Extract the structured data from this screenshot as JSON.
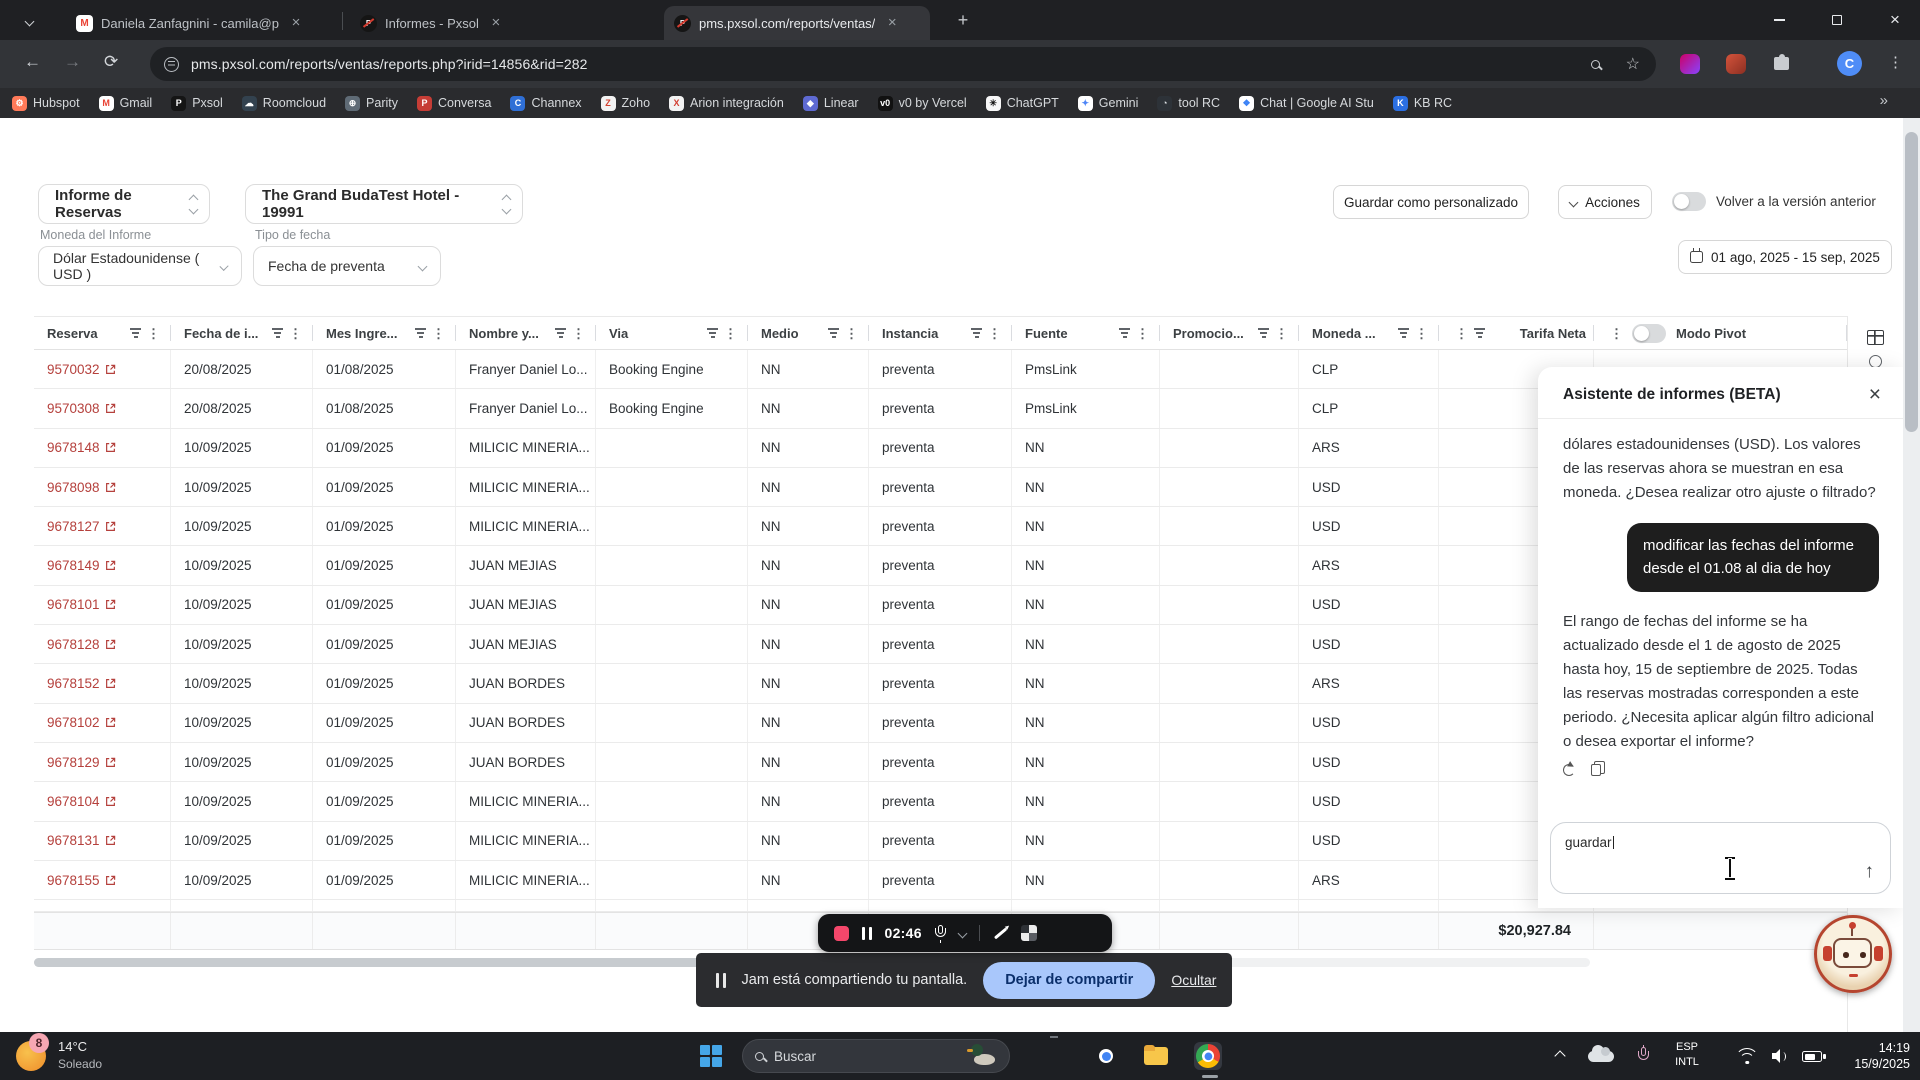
{
  "browser": {
    "tabs": [
      {
        "title": "Daniela Zanfagnini - camila@p",
        "favicon": "gmail"
      },
      {
        "title": "Informes - Pxsol",
        "favicon": "pxsol"
      },
      {
        "title": "pms.pxsol.com/reports/ventas/",
        "favicon": "pxsol"
      }
    ],
    "url": "pms.pxsol.com/reports/ventas/reports.php?irid=14856&rid=282",
    "profile_initial": "C",
    "bookmarks": [
      {
        "label": "Hubspot",
        "bg": "#ff7a59",
        "fg": "#ffffff",
        "glyph": "⚙"
      },
      {
        "label": "Gmail",
        "bg": "#ffffff",
        "fg": "#ea4335",
        "glyph": "M"
      },
      {
        "label": "Pxsol",
        "bg": "#151515",
        "fg": "#ffffff",
        "glyph": "P"
      },
      {
        "label": "Roomcloud",
        "bg": "#33424f",
        "fg": "#ffffff",
        "glyph": "☁"
      },
      {
        "label": "Parity",
        "bg": "#5f6b76",
        "fg": "#ffffff",
        "glyph": "⊕"
      },
      {
        "label": "Conversa",
        "bg": "#c63d36",
        "fg": "#ffffff",
        "glyph": "P"
      },
      {
        "label": "Channex",
        "bg": "#2f6fd6",
        "fg": "#ffffff",
        "glyph": "C"
      },
      {
        "label": "Zoho",
        "bg": "#f2f2f2",
        "fg": "#d3402e",
        "glyph": "Z"
      },
      {
        "label": "Arion integración",
        "bg": "#f2f2f2",
        "fg": "#d23b2f",
        "glyph": "X"
      },
      {
        "label": "Linear",
        "bg": "#5e6ad2",
        "fg": "#ffffff",
        "glyph": "◆"
      },
      {
        "label": "v0 by Vercel",
        "bg": "#111111",
        "fg": "#ffffff",
        "glyph": "v0"
      },
      {
        "label": "ChatGPT",
        "bg": "#f7f7f8",
        "fg": "#0f0f0f",
        "glyph": "✳"
      },
      {
        "label": "Gemini",
        "bg": "#ffffff",
        "fg": "#4e86f7",
        "glyph": "✦"
      },
      {
        "label": "tool RC",
        "bg": "#2d3238",
        "fg": "#dfe3e6",
        "glyph": "◔"
      },
      {
        "label": "Chat | Google AI Stu",
        "bg": "#ffffff",
        "fg": "#3b82f6",
        "glyph": "❖"
      },
      {
        "label": "KB RC",
        "bg": "#2b6fe3",
        "fg": "#ffffff",
        "glyph": "K"
      }
    ]
  },
  "report": {
    "report_select": "Informe de Reservas",
    "hotel_select": "The Grand BudaTest Hotel - 19991",
    "currency_label": "Moneda del Informe",
    "currency_value": "Dólar Estadounidense ( USD )",
    "datetype_label": "Tipo de fecha",
    "datetype_value": "Fecha de preventa",
    "save_button": "Guardar como personalizado",
    "actions_button": "Acciones",
    "legacy_toggle_label": "Volver a la versión anterior",
    "date_range": "01 ago, 2025 - 15 sep, 2025",
    "pivot_toggle_label": "Modo Pivot"
  },
  "table": {
    "columns": [
      "Reserva",
      "Fecha de i...",
      "Mes Ingre...",
      "Nombre y...",
      "Via",
      "Medio",
      "Instancia",
      "Fuente",
      "Promocio...",
      "Moneda ...",
      "Tarifa Neta"
    ],
    "rows": [
      {
        "reserva": "9570032",
        "fecha": "20/08/2025",
        "mes": "01/08/2025",
        "nombre": "Franyer Daniel Lo...",
        "via": "Booking Engine",
        "medio": "NN",
        "instancia": "preventa",
        "fuente": "PmsLink",
        "promocion": "",
        "moneda": "CLP",
        "tarifa": ""
      },
      {
        "reserva": "9570308",
        "fecha": "20/08/2025",
        "mes": "01/08/2025",
        "nombre": "Franyer Daniel Lo...",
        "via": "Booking Engine",
        "medio": "NN",
        "instancia": "preventa",
        "fuente": "PmsLink",
        "promocion": "",
        "moneda": "CLP",
        "tarifa": ""
      },
      {
        "reserva": "9678148",
        "fecha": "10/09/2025",
        "mes": "01/09/2025",
        "nombre": "MILICIC MINERIA...",
        "via": "",
        "medio": "NN",
        "instancia": "preventa",
        "fuente": "NN",
        "promocion": "",
        "moneda": "ARS",
        "tarifa": ""
      },
      {
        "reserva": "9678098",
        "fecha": "10/09/2025",
        "mes": "01/09/2025",
        "nombre": "MILICIC MINERIA...",
        "via": "",
        "medio": "NN",
        "instancia": "preventa",
        "fuente": "NN",
        "promocion": "",
        "moneda": "USD",
        "tarifa": ""
      },
      {
        "reserva": "9678127",
        "fecha": "10/09/2025",
        "mes": "01/09/2025",
        "nombre": "MILICIC MINERIA...",
        "via": "",
        "medio": "NN",
        "instancia": "preventa",
        "fuente": "NN",
        "promocion": "",
        "moneda": "USD",
        "tarifa": ""
      },
      {
        "reserva": "9678149",
        "fecha": "10/09/2025",
        "mes": "01/09/2025",
        "nombre": "JUAN MEJIAS",
        "via": "",
        "medio": "NN",
        "instancia": "preventa",
        "fuente": "NN",
        "promocion": "",
        "moneda": "ARS",
        "tarifa": ""
      },
      {
        "reserva": "9678101",
        "fecha": "10/09/2025",
        "mes": "01/09/2025",
        "nombre": "JUAN MEJIAS",
        "via": "",
        "medio": "NN",
        "instancia": "preventa",
        "fuente": "NN",
        "promocion": "",
        "moneda": "USD",
        "tarifa": ""
      },
      {
        "reserva": "9678128",
        "fecha": "10/09/2025",
        "mes": "01/09/2025",
        "nombre": "JUAN MEJIAS",
        "via": "",
        "medio": "NN",
        "instancia": "preventa",
        "fuente": "NN",
        "promocion": "",
        "moneda": "USD",
        "tarifa": ""
      },
      {
        "reserva": "9678152",
        "fecha": "10/09/2025",
        "mes": "01/09/2025",
        "nombre": "JUAN BORDES",
        "via": "",
        "medio": "NN",
        "instancia": "preventa",
        "fuente": "NN",
        "promocion": "",
        "moneda": "ARS",
        "tarifa": ""
      },
      {
        "reserva": "9678102",
        "fecha": "10/09/2025",
        "mes": "01/09/2025",
        "nombre": "JUAN BORDES",
        "via": "",
        "medio": "NN",
        "instancia": "preventa",
        "fuente": "NN",
        "promocion": "",
        "moneda": "USD",
        "tarifa": ""
      },
      {
        "reserva": "9678129",
        "fecha": "10/09/2025",
        "mes": "01/09/2025",
        "nombre": "JUAN BORDES",
        "via": "",
        "medio": "NN",
        "instancia": "preventa",
        "fuente": "NN",
        "promocion": "",
        "moneda": "USD",
        "tarifa": ""
      },
      {
        "reserva": "9678104",
        "fecha": "10/09/2025",
        "mes": "01/09/2025",
        "nombre": "MILICIC MINERIA...",
        "via": "",
        "medio": "NN",
        "instancia": "preventa",
        "fuente": "NN",
        "promocion": "",
        "moneda": "USD",
        "tarifa": ""
      },
      {
        "reserva": "9678131",
        "fecha": "10/09/2025",
        "mes": "01/09/2025",
        "nombre": "MILICIC MINERIA...",
        "via": "",
        "medio": "NN",
        "instancia": "preventa",
        "fuente": "NN",
        "promocion": "",
        "moneda": "USD",
        "tarifa": ""
      },
      {
        "reserva": "9678155",
        "fecha": "10/09/2025",
        "mes": "01/09/2025",
        "nombre": "MILICIC MINERIA...",
        "via": "",
        "medio": "NN",
        "instancia": "preventa",
        "fuente": "NN",
        "promocion": "",
        "moneda": "ARS",
        "tarifa": ""
      }
    ],
    "footer_total": "$20,927.84"
  },
  "chat": {
    "title": "Asistente de informes (BETA)",
    "messages": [
      {
        "role": "assistant",
        "text": "dólares estadounidenses (USD). Los valores de las reservas ahora se muestran en esa moneda. ¿Desea realizar otro ajuste o filtrado?"
      },
      {
        "role": "user",
        "text": "modificar las fechas del informe desde el 01.08 al dia de hoy"
      },
      {
        "role": "assistant",
        "text": "El rango de fechas del informe se ha actualizado desde el 1 de agosto de 2025 hasta hoy, 15 de septiembre de 2025. Todas las reservas mostradas corresponden a este periodo. ¿Necesita aplicar algún filtro adicional o desea exportar el informe?"
      }
    ],
    "input_value": "guardar"
  },
  "recorder": {
    "time": "02:46"
  },
  "share_bar": {
    "message": "Jam está compartiendo tu pantalla.",
    "stop_button": "Dejar de compartir",
    "hide_link": "Ocultar"
  },
  "taskbar": {
    "weather": {
      "temp": "14°C",
      "condition": "Soleado",
      "badge": "8"
    },
    "search_placeholder": "Buscar",
    "language": {
      "line1": "ESP",
      "line2": "INTL"
    },
    "clock": {
      "time": "14:19",
      "date": "15/9/2025"
    }
  }
}
